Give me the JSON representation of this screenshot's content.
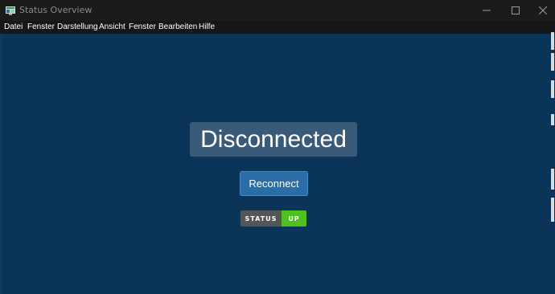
{
  "window": {
    "title": "Status Overview",
    "app_icon": "app-window-icon"
  },
  "controls": {
    "minimize_icon": "minimize-icon",
    "maximize_icon": "maximize-icon",
    "close_icon": "close-icon"
  },
  "menubar": {
    "items": [
      "Datei",
      "Fenster",
      "Darstellung",
      "Ansicht",
      "Fenster",
      "Bearbeiten",
      "Hilfe"
    ]
  },
  "main": {
    "status_text": "Disconnected",
    "reconnect_label": "Reconnect",
    "badge": {
      "label": "STATUS",
      "value": "UP"
    }
  },
  "colors": {
    "background": "#0b3558",
    "headline_bg": "#3a5a7a",
    "button_bg": "#2b6da6",
    "badge_label_bg": "#555555",
    "badge_value_bg": "#4fc11f"
  }
}
